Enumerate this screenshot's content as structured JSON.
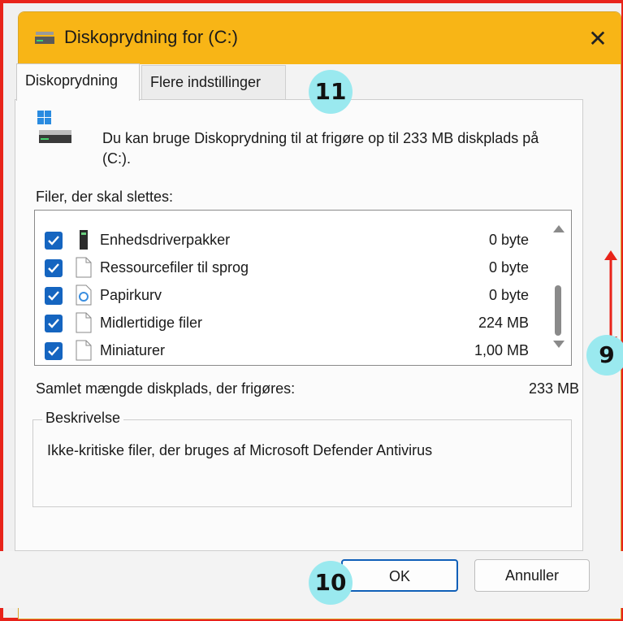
{
  "window": {
    "title": "Diskoprydning for  (C:)",
    "close_glyph": "✕"
  },
  "tabs": [
    {
      "label": "Diskoprydning",
      "active": true
    },
    {
      "label": "Flere indstillinger",
      "active": false
    }
  ],
  "intro_text": "Du kan bruge Diskoprydning til at frigøre op til 233 MB diskplads på  (C:).",
  "files_label": "Filer, der skal slettes:",
  "files": [
    {
      "name": "Enhedsdriverpakker",
      "size": "0 byte",
      "checked": true,
      "icon": "driver-package-icon"
    },
    {
      "name": "Ressourcefiler til sprog",
      "size": "0 byte",
      "checked": true,
      "icon": "file-icon"
    },
    {
      "name": "Papirkurv",
      "size": "0 byte",
      "checked": true,
      "icon": "recycle-bin-icon"
    },
    {
      "name": "Midlertidige filer",
      "size": "224 MB",
      "checked": true,
      "icon": "file-icon"
    },
    {
      "name": "Miniaturer",
      "size": "1,00 MB",
      "checked": true,
      "icon": "file-icon"
    }
  ],
  "total": {
    "label": "Samlet mængde diskplads, der frigøres:",
    "value": "233 MB"
  },
  "description": {
    "legend": "Beskrivelse",
    "text": "Ikke-kritiske filer, der bruges af Microsoft Defender Antivirus"
  },
  "buttons": {
    "ok": "OK",
    "cancel": "Annuller"
  },
  "annotations": {
    "badge_tabs": "11",
    "badge_scroll": "9",
    "badge_ok": "10"
  },
  "colors": {
    "titlebar": "#f8b516",
    "checkbox": "#1565c0",
    "badge": "#9ae9ef",
    "annotation_arrow": "#e8231a",
    "frame": "#e8231a"
  }
}
